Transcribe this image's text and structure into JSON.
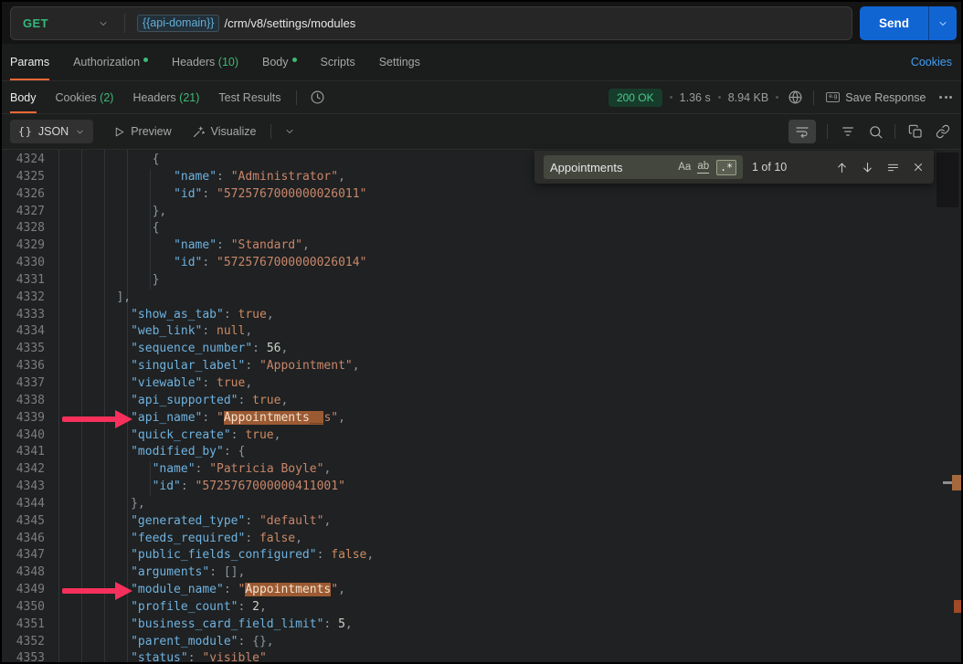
{
  "colors": {
    "accent_orange": "#f26836",
    "green": "#3dba75",
    "get_green": "#35b878",
    "link_blue": "#409ff7",
    "send_blue": "#1165d3",
    "status_text": "#49c98c",
    "status_bg": "#173c2b",
    "key_blue": "#6fb2e0",
    "string_orange": "#c9866b",
    "bool_orange": "#cd8a64",
    "number_gray": "#ccd4c6",
    "punct_gray": "#8f969e",
    "highlight_bg": "#9c5a33",
    "highlight_text": "#f3e3cd",
    "highlight_dark_text": "#45260f",
    "arrow_pink": "#f6305c",
    "var_blue": "#64aed6"
  },
  "request": {
    "method": "GET",
    "url_variable": "{{api-domain}}",
    "url_path": "/crm/v8/settings/modules",
    "send_label": "Send"
  },
  "request_tabs": {
    "items": [
      {
        "label": "Params"
      },
      {
        "label": "Authorization"
      },
      {
        "label": "Headers",
        "count": "(10)"
      },
      {
        "label": "Body"
      },
      {
        "label": "Scripts"
      },
      {
        "label": "Settings"
      }
    ],
    "cookies_link": "Cookies"
  },
  "response_tabs": {
    "items": [
      {
        "label": "Body"
      },
      {
        "label": "Cookies",
        "count": "(2)"
      },
      {
        "label": "Headers",
        "count": "(21)"
      },
      {
        "label": "Test Results"
      }
    ]
  },
  "response_meta": {
    "status": "200 OK",
    "time": "1.36 s",
    "size": "8.94 KB",
    "example_icon": "e.g",
    "save_label": "Save Response"
  },
  "viewer": {
    "format": "JSON",
    "braces_icon": "{}",
    "preview_label": "Preview",
    "visualize_label": "Visualize"
  },
  "search": {
    "query": "Appointments",
    "match_case": "Aa",
    "whole_word": "ab",
    "regex": ".*",
    "count": "1 of 10"
  },
  "code": {
    "lines": [
      {
        "n": "4324",
        "p": [
          [
            "w",
            "              "
          ],
          [
            "p",
            "{"
          ]
        ]
      },
      {
        "n": "4325",
        "p": [
          [
            "w",
            "                 "
          ],
          [
            "k",
            "\"name\""
          ],
          [
            "p",
            ": "
          ],
          [
            "s",
            "\"Administrator\""
          ],
          [
            "p",
            ","
          ]
        ]
      },
      {
        "n": "4326",
        "p": [
          [
            "w",
            "                 "
          ],
          [
            "k",
            "\"id\""
          ],
          [
            "p",
            ": "
          ],
          [
            "s",
            "\"5725767000000026011\""
          ]
        ]
      },
      {
        "n": "4327",
        "p": [
          [
            "w",
            "              "
          ],
          [
            "p",
            "},"
          ]
        ]
      },
      {
        "n": "4328",
        "p": [
          [
            "w",
            "              "
          ],
          [
            "p",
            "{"
          ]
        ]
      },
      {
        "n": "4329",
        "p": [
          [
            "w",
            "                 "
          ],
          [
            "k",
            "\"name\""
          ],
          [
            "p",
            ": "
          ],
          [
            "s",
            "\"Standard\""
          ],
          [
            "p",
            ","
          ]
        ]
      },
      {
        "n": "4330",
        "p": [
          [
            "w",
            "                 "
          ],
          [
            "k",
            "\"id\""
          ],
          [
            "p",
            ": "
          ],
          [
            "s",
            "\"5725767000000026014\""
          ]
        ]
      },
      {
        "n": "4331",
        "p": [
          [
            "w",
            "              "
          ],
          [
            "p",
            "}"
          ]
        ]
      },
      {
        "n": "4332",
        "p": [
          [
            "w",
            "         "
          ],
          [
            "p",
            "],"
          ]
        ]
      },
      {
        "n": "4333",
        "p": [
          [
            "w",
            "           "
          ],
          [
            "k",
            "\"show_as_tab\""
          ],
          [
            "p",
            ": "
          ],
          [
            "b",
            "true"
          ],
          [
            "p",
            ","
          ]
        ]
      },
      {
        "n": "4334",
        "p": [
          [
            "w",
            "           "
          ],
          [
            "k",
            "\"web_link\""
          ],
          [
            "p",
            ": "
          ],
          [
            "b",
            "null"
          ],
          [
            "p",
            ","
          ]
        ]
      },
      {
        "n": "4335",
        "p": [
          [
            "w",
            "           "
          ],
          [
            "k",
            "\"sequence_number\""
          ],
          [
            "p",
            ": "
          ],
          [
            "n",
            "56"
          ],
          [
            "p",
            ","
          ]
        ]
      },
      {
        "n": "4336",
        "p": [
          [
            "w",
            "           "
          ],
          [
            "k",
            "\"singular_label\""
          ],
          [
            "p",
            ": "
          ],
          [
            "s",
            "\"Appointment\""
          ],
          [
            "p",
            ","
          ]
        ]
      },
      {
        "n": "4337",
        "p": [
          [
            "w",
            "           "
          ],
          [
            "k",
            "\"viewable\""
          ],
          [
            "p",
            ": "
          ],
          [
            "b",
            "true"
          ],
          [
            "p",
            ","
          ]
        ]
      },
      {
        "n": "4338",
        "p": [
          [
            "w",
            "           "
          ],
          [
            "k",
            "\"api_supported\""
          ],
          [
            "p",
            ": "
          ],
          [
            "b",
            "true"
          ],
          [
            "p",
            ","
          ]
        ]
      },
      {
        "n": "4339",
        "p": [
          [
            "w",
            "           "
          ],
          [
            "k",
            "\"api_name\""
          ],
          [
            "p",
            ": "
          ],
          [
            "s",
            "\""
          ],
          [
            "hl",
            "Appointments"
          ],
          [
            "hld",
            "__"
          ],
          [
            "s",
            "s\""
          ],
          [
            "p",
            ","
          ]
        ]
      },
      {
        "n": "4340",
        "p": [
          [
            "w",
            "           "
          ],
          [
            "k",
            "\"quick_create\""
          ],
          [
            "p",
            ": "
          ],
          [
            "b",
            "true"
          ],
          [
            "p",
            ","
          ]
        ]
      },
      {
        "n": "4341",
        "p": [
          [
            "w",
            "           "
          ],
          [
            "k",
            "\"modified_by\""
          ],
          [
            "p",
            ": {"
          ]
        ]
      },
      {
        "n": "4342",
        "p": [
          [
            "w",
            "              "
          ],
          [
            "k",
            "\"name\""
          ],
          [
            "p",
            ": "
          ],
          [
            "s",
            "\"Patricia Boyle\""
          ],
          [
            "p",
            ","
          ]
        ]
      },
      {
        "n": "4343",
        "p": [
          [
            "w",
            "              "
          ],
          [
            "k",
            "\"id\""
          ],
          [
            "p",
            ": "
          ],
          [
            "s",
            "\"5725767000000411001\""
          ]
        ]
      },
      {
        "n": "4344",
        "p": [
          [
            "w",
            "           "
          ],
          [
            "p",
            "},"
          ]
        ]
      },
      {
        "n": "4345",
        "p": [
          [
            "w",
            "           "
          ],
          [
            "k",
            "\"generated_type\""
          ],
          [
            "p",
            ": "
          ],
          [
            "s",
            "\"default\""
          ],
          [
            "p",
            ","
          ]
        ]
      },
      {
        "n": "4346",
        "p": [
          [
            "w",
            "           "
          ],
          [
            "k",
            "\"feeds_required\""
          ],
          [
            "p",
            ": "
          ],
          [
            "b",
            "false"
          ],
          [
            "p",
            ","
          ]
        ]
      },
      {
        "n": "4347",
        "p": [
          [
            "w",
            "           "
          ],
          [
            "k",
            "\"public_fields_configured\""
          ],
          [
            "p",
            ": "
          ],
          [
            "b",
            "false"
          ],
          [
            "p",
            ","
          ]
        ]
      },
      {
        "n": "4348",
        "p": [
          [
            "w",
            "           "
          ],
          [
            "k",
            "\"arguments\""
          ],
          [
            "p",
            ": [],"
          ]
        ]
      },
      {
        "n": "4349",
        "p": [
          [
            "w",
            "           "
          ],
          [
            "k",
            "\"module_name\""
          ],
          [
            "p",
            ": "
          ],
          [
            "s",
            "\""
          ],
          [
            "hl",
            "Appointments"
          ],
          [
            "s",
            "\""
          ],
          [
            "p",
            ","
          ]
        ]
      },
      {
        "n": "4350",
        "p": [
          [
            "w",
            "           "
          ],
          [
            "k",
            "\"profile_count\""
          ],
          [
            "p",
            ": "
          ],
          [
            "n",
            "2"
          ],
          [
            "p",
            ","
          ]
        ]
      },
      {
        "n": "4351",
        "p": [
          [
            "w",
            "           "
          ],
          [
            "k",
            "\"business_card_field_limit\""
          ],
          [
            "p",
            ": "
          ],
          [
            "n",
            "5"
          ],
          [
            "p",
            ","
          ]
        ]
      },
      {
        "n": "4352",
        "p": [
          [
            "w",
            "           "
          ],
          [
            "k",
            "\"parent_module\""
          ],
          [
            "p",
            ": {},"
          ]
        ]
      },
      {
        "n": "4353",
        "p": [
          [
            "w",
            "           "
          ],
          [
            "k",
            "\"status\""
          ],
          [
            "p",
            ": "
          ],
          [
            "s",
            "\"visible\""
          ]
        ]
      }
    ]
  }
}
